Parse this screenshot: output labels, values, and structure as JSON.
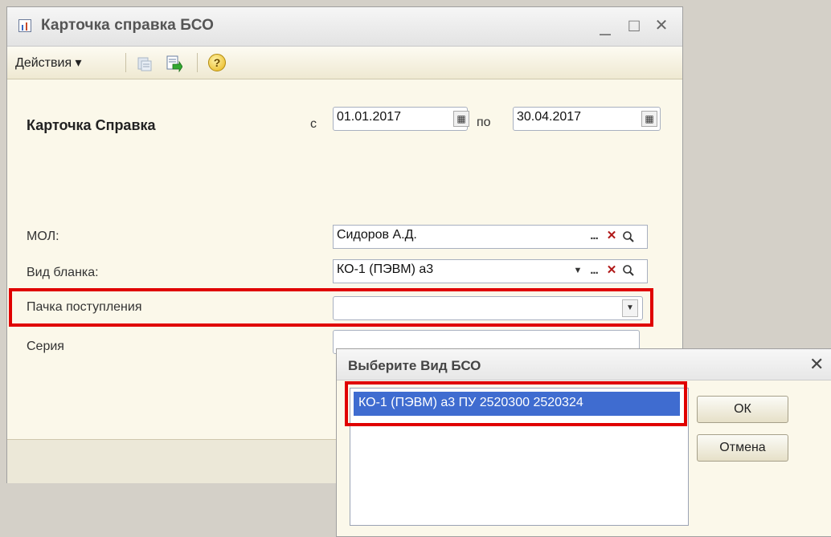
{
  "window": {
    "title": "Карточка справка БСО",
    "controls": {
      "minimize": "_",
      "maximize": "□",
      "close": "✕"
    }
  },
  "toolbar": {
    "actions_label": "Действия ▾",
    "help_label": "?"
  },
  "form": {
    "heading": "Карточка Справка",
    "from_label": "с",
    "from_date": "01.01.2017",
    "to_label": "по",
    "to_date": "30.04.2017",
    "mol_label": "МОЛ:",
    "mol_value": "Сидоров А.Д.",
    "blank_type_label": "Вид бланка:",
    "blank_type_value": "КО-1 (ПЭВМ)  а3",
    "batch_label": "Пачка поступления",
    "batch_value": "",
    "series_label": "Серия"
  },
  "icons": {
    "calendar": "calendar-icon",
    "select": "ellipsis-icon",
    "clear": "clear-x-icon",
    "search": "magnifier-icon",
    "dropdown": "chevron-down-icon",
    "glyph_ellipsis": "...",
    "glyph_clear": "✕",
    "glyph_search": "🔍",
    "glyph_dropdown": "▼",
    "glyph_calendar": "▦"
  },
  "dialog": {
    "title": "Выберите Вид БСО",
    "close": "✕",
    "items": [
      "КО-1 (ПЭВМ)  а3 ПУ 2520300 2520324"
    ],
    "ok_label": "ОК",
    "cancel_label": "Отмена"
  },
  "colors": {
    "highlight_red": "#e00000",
    "selection_blue": "#3f6cd0",
    "form_bg": "#fbf8ea"
  }
}
